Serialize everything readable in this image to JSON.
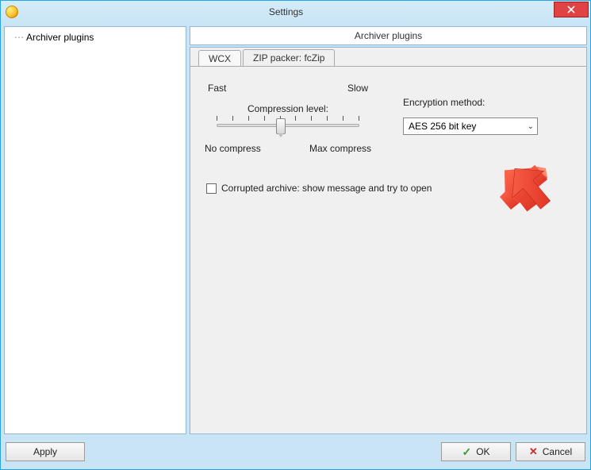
{
  "window": {
    "title": "Settings"
  },
  "sidebar": {
    "items": [
      {
        "label": "Archiver plugins"
      }
    ]
  },
  "panel": {
    "title": "Archiver plugins"
  },
  "tabs": [
    {
      "label": "WCX",
      "active": false
    },
    {
      "label": "ZIP packer: fcZip",
      "active": true
    }
  ],
  "compression": {
    "fast_label": "Fast",
    "slow_label": "Slow",
    "level_label": "Compression level:",
    "no_compress_label": "No compress",
    "max_compress_label": "Max compress",
    "ticks": 10,
    "value_index": 4
  },
  "encryption": {
    "label": "Encryption method:",
    "selected": "AES 256 bit key"
  },
  "corrupted_checkbox": {
    "checked": false,
    "label": "Corrupted archive: show message and try to open"
  },
  "footer": {
    "apply_label": "Apply",
    "ok_label": "OK",
    "cancel_label": "Cancel"
  }
}
